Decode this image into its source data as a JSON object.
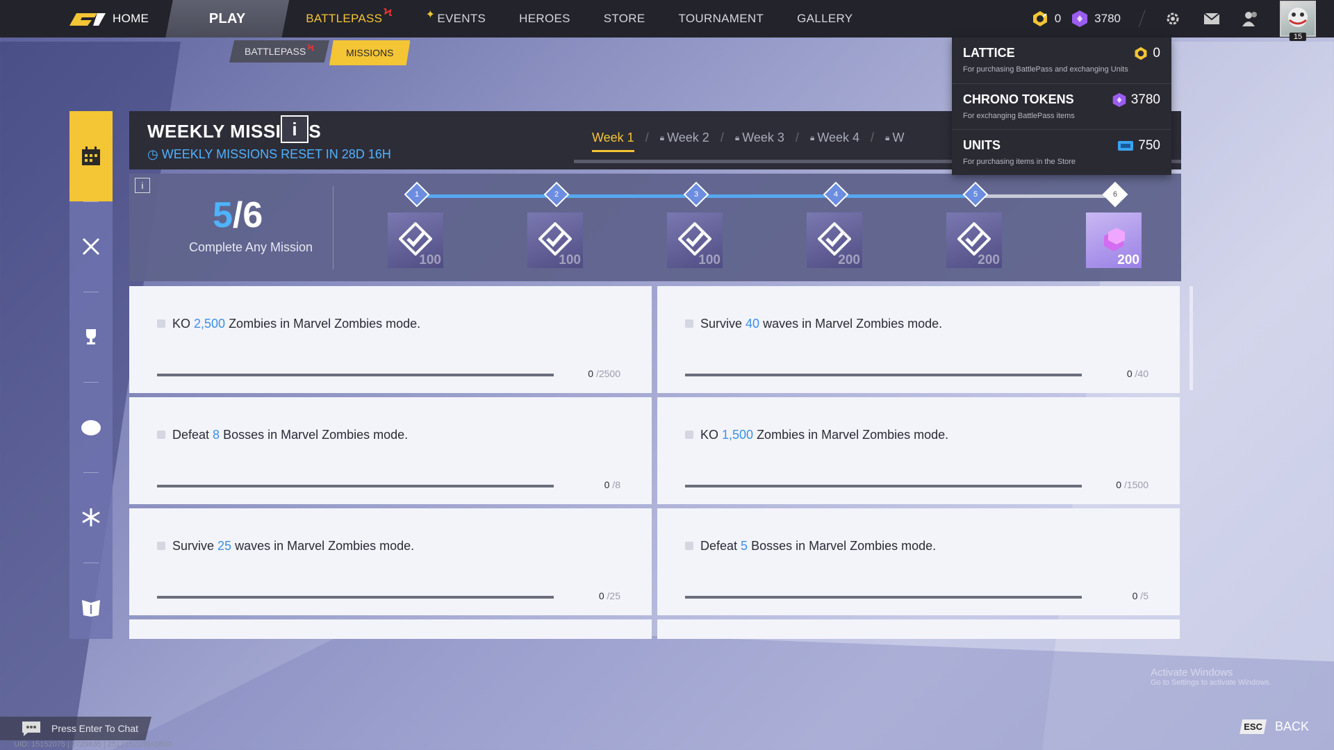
{
  "nav": {
    "home": "HOME",
    "play": "PLAY",
    "battlepass": "BATTLEPASS",
    "events": "EVENTS",
    "heroes": "HEROES",
    "store": "STORE",
    "tournament": "TOURNAMENT",
    "gallery": "GALLERY"
  },
  "currencies": {
    "lattice": "0",
    "chrono": "3780"
  },
  "avatar": {
    "level": "15"
  },
  "subtabs": {
    "battlepass": "BATTLEPASS",
    "missions": "MISSIONS"
  },
  "header": {
    "title": "WEEKLY MISSIONS",
    "info": "i",
    "reset": "WEEKLY MISSIONS RESET IN 28D 16H",
    "weeks": [
      "Week 1",
      "Week 2",
      "Week 3",
      "Week 4",
      "W"
    ]
  },
  "progress": {
    "done": "5",
    "slash": "/",
    "total": "6",
    "label": "Complete Any Mission",
    "milestones": [
      {
        "num": "1",
        "amount": "100",
        "claimed": true
      },
      {
        "num": "2",
        "amount": "100",
        "claimed": true
      },
      {
        "num": "3",
        "amount": "100",
        "claimed": true
      },
      {
        "num": "4",
        "amount": "200",
        "claimed": true
      },
      {
        "num": "5",
        "amount": "200",
        "claimed": true
      },
      {
        "num": "6",
        "amount": "200",
        "claimed": false
      }
    ]
  },
  "missions": [
    {
      "pre": "KO ",
      "hl": "2,500",
      "post": " Zombies in Marvel Zombies mode.",
      "cur": "0",
      "tot": " /2500"
    },
    {
      "pre": "Survive ",
      "hl": "40",
      "post": " waves in Marvel Zombies mode.",
      "cur": "0",
      "tot": " /40"
    },
    {
      "pre": "Defeat ",
      "hl": "8",
      "post": " Bosses in Marvel Zombies mode.",
      "cur": "0",
      "tot": " /8"
    },
    {
      "pre": "KO ",
      "hl": "1,500",
      "post": " Zombies in Marvel Zombies mode.",
      "cur": "0",
      "tot": " /1500"
    },
    {
      "pre": "Survive ",
      "hl": "25",
      "post": " waves in Marvel Zombies mode.",
      "cur": "0",
      "tot": " /25"
    },
    {
      "pre": "Defeat ",
      "hl": "5",
      "post": " Bosses in Marvel Zombies mode.",
      "cur": "0",
      "tot": " /5"
    }
  ],
  "popup": {
    "lattice": {
      "name": "LATTICE",
      "value": "0",
      "desc": "For purchasing BattlePass and exchanging Units"
    },
    "chrono": {
      "name": "CHRONO TOKENS",
      "value": "3780",
      "desc": "For exchanging BattlePass items"
    },
    "units": {
      "name": "UNITS",
      "value": "750",
      "desc": "For purchasing items in the Store"
    }
  },
  "chat": {
    "text": "Press Enter To Chat"
  },
  "uid": "UID: 15152075 | 2729635 | 2512152109+0800",
  "back": {
    "key": "ESC",
    "label": "BACK"
  },
  "activate": {
    "line1": "Activate Windows",
    "line2": "Go to Settings to activate Windows."
  },
  "colors": {
    "accent": "#f4c534",
    "highlight": "#3c8fe8",
    "progress": "#56a9f0",
    "topbar": "#23232b"
  }
}
